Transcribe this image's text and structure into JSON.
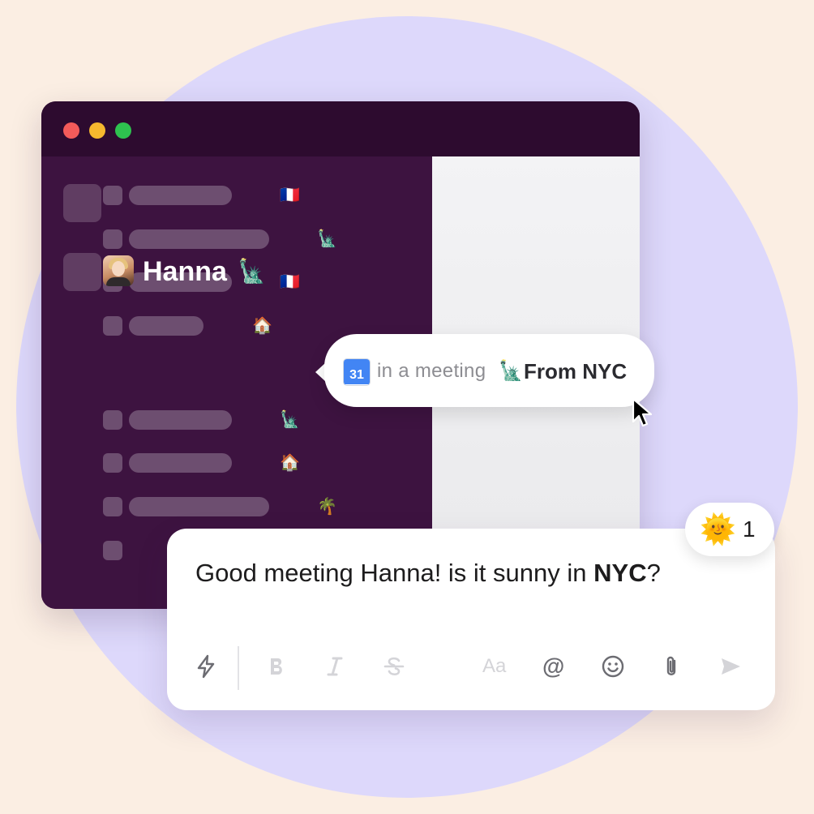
{
  "sidebar": {
    "contacts": [
      {
        "emoji": "🇫🇷"
      },
      {
        "emoji": "🗽"
      },
      {
        "emoji": "🇫🇷"
      },
      {
        "emoji": "🏠"
      },
      {
        "name": "Hanna",
        "emoji": "🗽"
      },
      {
        "emoji": "🗽"
      },
      {
        "emoji": "🏠"
      },
      {
        "emoji": "🌴"
      }
    ]
  },
  "tooltip": {
    "calendar_day": "31",
    "status": "in a meeting",
    "emoji": "🗽",
    "location": "From NYC"
  },
  "composer": {
    "message_prefix": "Good meeting Hanna! is it sunny in ",
    "message_bold": "NYC",
    "message_suffix": "?",
    "format_label": "Aa",
    "mention_symbol": "@"
  },
  "reaction": {
    "emoji": "🌞",
    "count": "1"
  },
  "icons": [
    "lightning-icon",
    "bold-icon",
    "italic-icon",
    "strikethrough-icon",
    "text-format-icon",
    "mention-icon",
    "emoji-icon",
    "attachment-icon",
    "send-icon",
    "cursor-icon"
  ]
}
